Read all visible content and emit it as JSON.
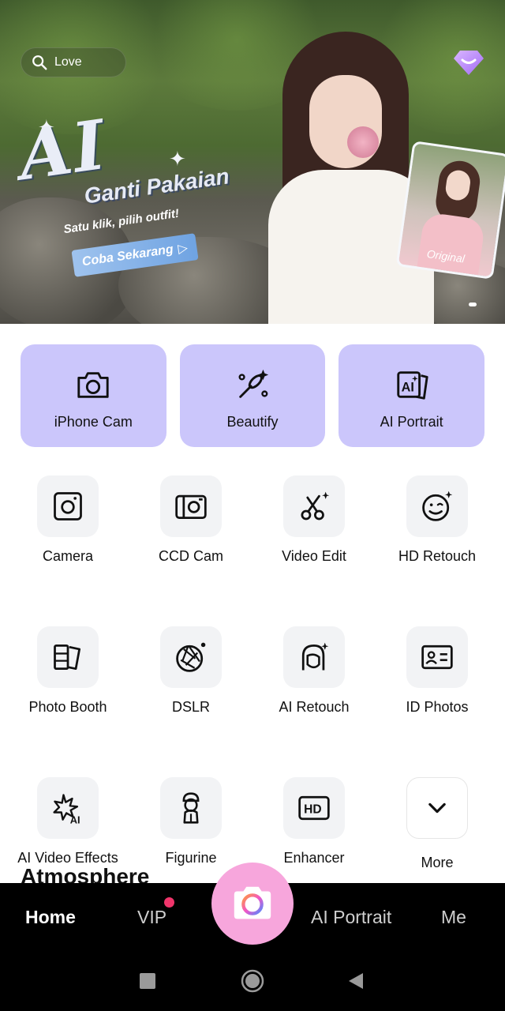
{
  "search": {
    "text": "Love"
  },
  "banner": {
    "headline": "AI",
    "title": "Ganti Pakaian",
    "subtitle": "Satu klik, pilih outfit!",
    "cta": "Coba Sekarang",
    "thumb_label": "Original"
  },
  "cards": [
    {
      "label": "iPhone Cam",
      "icon": "camera-icon"
    },
    {
      "label": "Beautify",
      "icon": "makeup-brush-icon"
    },
    {
      "label": "AI Portrait",
      "icon": "ai-portrait-icon"
    }
  ],
  "tools": [
    {
      "label": "Camera",
      "icon": "camera-square-icon"
    },
    {
      "label": "CCD Cam",
      "icon": "ccd-camera-icon"
    },
    {
      "label": "Video Edit",
      "icon": "scissors-icon"
    },
    {
      "label": "HD Retouch",
      "icon": "wink-face-icon"
    },
    {
      "label": "Photo Booth",
      "icon": "photo-strip-icon"
    },
    {
      "label": "DSLR",
      "icon": "aperture-icon"
    },
    {
      "label": "AI Retouch",
      "icon": "face-sparkle-icon"
    },
    {
      "label": "ID Photos",
      "icon": "id-card-icon"
    },
    {
      "label": "AI Video Effects",
      "icon": "ai-burst-icon"
    },
    {
      "label": "Figurine",
      "icon": "figurine-icon"
    },
    {
      "label": "Enhancer",
      "icon": "hd-icon"
    },
    {
      "label": "More",
      "icon": "chevron-down-icon"
    }
  ],
  "section_title": "Atmosphere",
  "nav": {
    "home": "Home",
    "vip": "VIP",
    "ai_portrait": "AI Portrait",
    "me": "Me"
  },
  "colors": {
    "card_bg": "#cbc6fb",
    "tool_bg": "#f2f3f5",
    "fab": "#f7a6dc",
    "badge": "#f0356b",
    "nav_bg": "#000000"
  }
}
